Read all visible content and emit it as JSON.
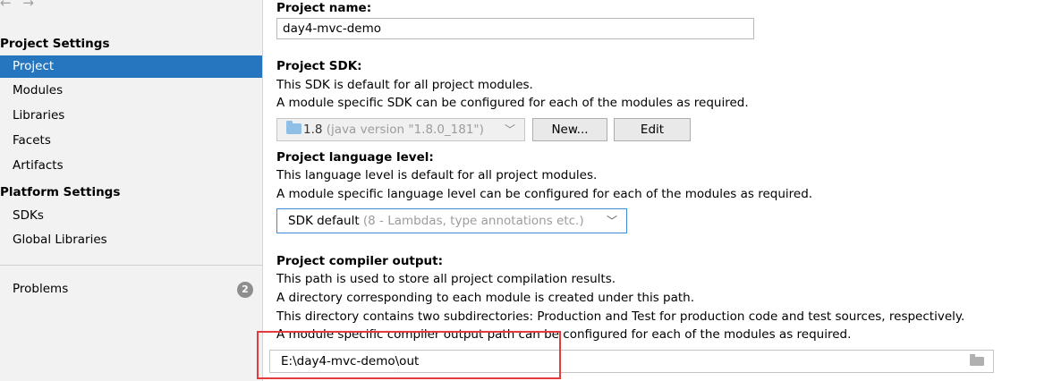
{
  "nav": {
    "back_icon": "arrow-left-icon",
    "forward_icon": "arrow-right-icon",
    "arrows": "← →"
  },
  "sidebar": {
    "project_settings_header": "Project Settings",
    "project_items": [
      {
        "label": "Project",
        "selected": true
      },
      {
        "label": "Modules"
      },
      {
        "label": "Libraries"
      },
      {
        "label": "Facets"
      },
      {
        "label": "Artifacts"
      }
    ],
    "platform_settings_header": "Platform Settings",
    "platform_items": [
      {
        "label": "SDKs"
      },
      {
        "label": "Global Libraries"
      }
    ],
    "problems_label": "Problems",
    "problems_count": "2"
  },
  "main": {
    "project_name_label": "Project name:",
    "project_name_value": "day4-mvc-demo",
    "sdk_label": "Project SDK:",
    "sdk_desc1": "This SDK is default for all project modules.",
    "sdk_desc2": "A module specific SDK can be configured for each of the modules as required.",
    "sdk_selected_version": "1.8",
    "sdk_selected_detail": " (java version \"1.8.0_181\")",
    "sdk_new_button": "New...",
    "sdk_edit_button": "Edit",
    "lang_label": "Project language level:",
    "lang_desc1": "This language level is default for all project modules.",
    "lang_desc2": "A module specific language level can be configured for each of the modules as required.",
    "lang_selected": "SDK default",
    "lang_selected_detail": " (8 - Lambdas, type annotations etc.)",
    "compiler_label": "Project compiler output:",
    "compiler_desc1": "This path is used to store all project compilation results.",
    "compiler_desc2": "A directory corresponding to each module is created under this path.",
    "compiler_desc3": "This directory contains two subdirectories: Production and Test for production code and test sources, respectively.",
    "compiler_desc4": "A module specific compiler output path can be configured for each of the modules as required.",
    "compiler_output_value": "E:\\day4-mvc-demo\\out"
  },
  "colors": {
    "selection": "#2675bf",
    "highlight_box": "#e53b3b",
    "focus_border": "#3c8ad8"
  }
}
